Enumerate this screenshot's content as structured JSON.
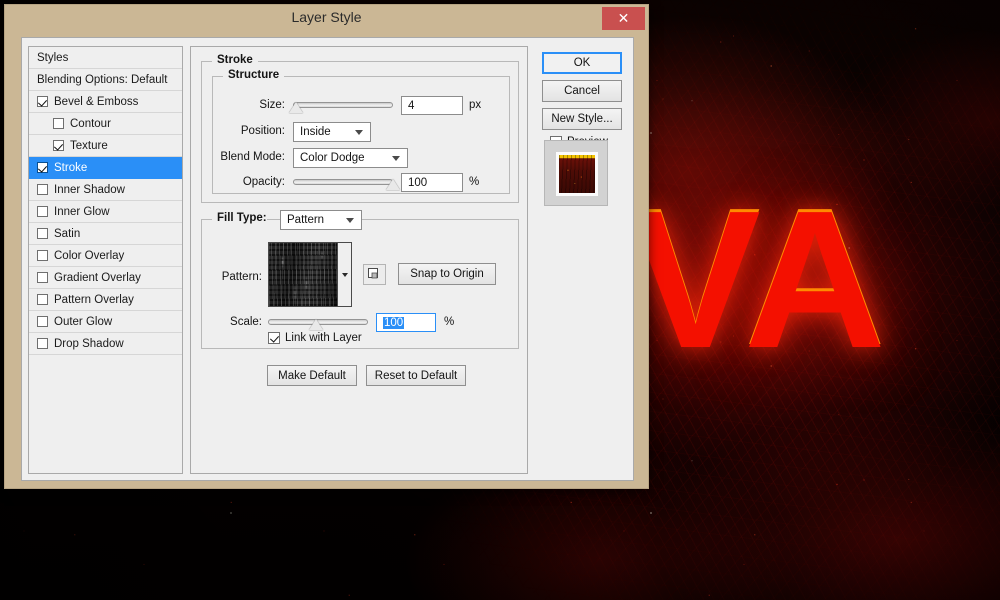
{
  "background": {
    "word": "VA",
    "description": "lava-text-canvas"
  },
  "dialog": {
    "title": "Layer Style",
    "close_label": "✕"
  },
  "styles_panel": {
    "header": "Styles",
    "blending_options": "Blending Options: Default",
    "items": [
      {
        "label": "Bevel & Emboss",
        "checked": true,
        "indent": false,
        "selected": false
      },
      {
        "label": "Contour",
        "checked": false,
        "indent": true,
        "selected": false
      },
      {
        "label": "Texture",
        "checked": true,
        "indent": true,
        "selected": false
      },
      {
        "label": "Stroke",
        "checked": true,
        "indent": false,
        "selected": true
      },
      {
        "label": "Inner Shadow",
        "checked": false,
        "indent": false,
        "selected": false
      },
      {
        "label": "Inner Glow",
        "checked": false,
        "indent": false,
        "selected": false
      },
      {
        "label": "Satin",
        "checked": false,
        "indent": false,
        "selected": false
      },
      {
        "label": "Color Overlay",
        "checked": false,
        "indent": false,
        "selected": false
      },
      {
        "label": "Gradient Overlay",
        "checked": false,
        "indent": false,
        "selected": false
      },
      {
        "label": "Pattern Overlay",
        "checked": false,
        "indent": false,
        "selected": false
      },
      {
        "label": "Outer Glow",
        "checked": false,
        "indent": false,
        "selected": false
      },
      {
        "label": "Drop Shadow",
        "checked": false,
        "indent": false,
        "selected": false
      }
    ]
  },
  "stroke": {
    "group_label": "Stroke",
    "structure": {
      "group_label": "Structure",
      "size_label": "Size:",
      "size_value": "4",
      "size_unit": "px",
      "size_slider_percent": 3,
      "position_label": "Position:",
      "position_value": "Inside",
      "blend_mode_label": "Blend Mode:",
      "blend_mode_value": "Color Dodge",
      "opacity_label": "Opacity:",
      "opacity_value": "100",
      "opacity_unit": "%",
      "opacity_slider_percent": 100
    },
    "fill": {
      "fill_type_label": "Fill Type:",
      "fill_type_value": "Pattern",
      "pattern_label": "Pattern:",
      "snap_to_origin_label": "Snap to Origin",
      "scale_label": "Scale:",
      "scale_value": "100",
      "scale_unit": "%",
      "scale_slider_percent": 48,
      "link_with_layer_label": "Link with Layer",
      "link_with_layer_checked": true
    },
    "make_default_label": "Make Default",
    "reset_to_default_label": "Reset to Default"
  },
  "actions": {
    "ok_label": "OK",
    "cancel_label": "Cancel",
    "new_style_label": "New Style...",
    "preview_label": "Preview",
    "preview_checked": true
  },
  "colors": {
    "titlebar": "#cbb795",
    "close_button": "#c9504f",
    "selection": "#2a8ff7",
    "panel": "#efefef",
    "lava_red": "#f41000",
    "lava_orange": "#ff8a00"
  }
}
